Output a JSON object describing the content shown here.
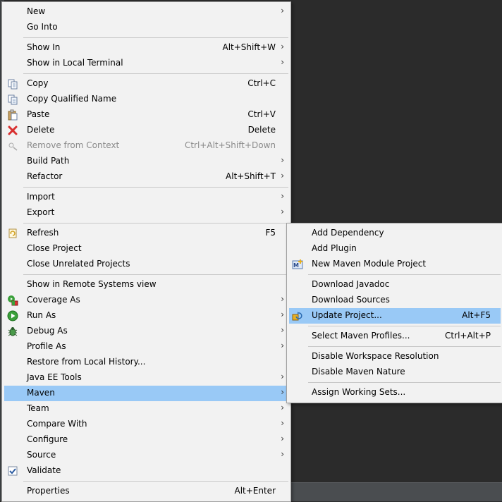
{
  "main_menu": {
    "new": {
      "label": "New"
    },
    "go_into": {
      "label": "Go Into"
    },
    "show_in": {
      "label": "Show In",
      "shortcut": "Alt+Shift+W"
    },
    "show_local_terminal": {
      "label": "Show in Local Terminal"
    },
    "copy": {
      "label": "Copy",
      "shortcut": "Ctrl+C",
      "icon": "copy-icon"
    },
    "copy_qualified": {
      "label": "Copy Qualified Name",
      "icon": "copy-qualified-icon"
    },
    "paste": {
      "label": "Paste",
      "shortcut": "Ctrl+V",
      "icon": "paste-icon"
    },
    "delete": {
      "label": "Delete",
      "shortcut": "Delete",
      "icon": "delete-icon"
    },
    "remove_context": {
      "label": "Remove from Context",
      "shortcut": "Ctrl+Alt+Shift+Down",
      "icon": "remove-context-icon"
    },
    "build_path": {
      "label": "Build Path"
    },
    "refactor": {
      "label": "Refactor",
      "shortcut": "Alt+Shift+T"
    },
    "import": {
      "label": "Import"
    },
    "export": {
      "label": "Export"
    },
    "refresh": {
      "label": "Refresh",
      "shortcut": "F5",
      "icon": "refresh-icon"
    },
    "close_project": {
      "label": "Close Project"
    },
    "close_unrelated": {
      "label": "Close Unrelated Projects"
    },
    "show_remote": {
      "label": "Show in Remote Systems view"
    },
    "coverage_as": {
      "label": "Coverage As",
      "icon": "coverage-icon"
    },
    "run_as": {
      "label": "Run As",
      "icon": "run-icon"
    },
    "debug_as": {
      "label": "Debug As",
      "icon": "debug-icon"
    },
    "profile_as": {
      "label": "Profile As"
    },
    "restore_history": {
      "label": "Restore from Local History..."
    },
    "java_ee_tools": {
      "label": "Java EE Tools"
    },
    "maven": {
      "label": "Maven"
    },
    "team": {
      "label": "Team"
    },
    "compare_with": {
      "label": "Compare With"
    },
    "configure": {
      "label": "Configure"
    },
    "source": {
      "label": "Source"
    },
    "validate": {
      "label": "Validate",
      "icon": "checkmark-icon"
    },
    "properties": {
      "label": "Properties",
      "shortcut": "Alt+Enter"
    },
    "arrow": "›"
  },
  "maven_menu": {
    "add_dependency": {
      "label": "Add Dependency"
    },
    "add_plugin": {
      "label": "Add Plugin"
    },
    "new_module": {
      "label": "New Maven Module Project",
      "icon": "maven-module-icon"
    },
    "download_javadoc": {
      "label": "Download Javadoc"
    },
    "download_sources": {
      "label": "Download Sources"
    },
    "update_project": {
      "label": "Update Project...",
      "shortcut": "Alt+F5",
      "icon": "update-project-icon"
    },
    "select_profiles": {
      "label": "Select Maven Profiles...",
      "shortcut": "Ctrl+Alt+P"
    },
    "disable_workspace": {
      "label": "Disable Workspace Resolution"
    },
    "disable_nature": {
      "label": "Disable Maven Nature"
    },
    "assign_working_sets": {
      "label": "Assign Working Sets..."
    }
  },
  "colors": {
    "highlight": "#99c9f6",
    "menu_bg": "#f2f2f2",
    "disabled_text": "#8a8a8a"
  }
}
